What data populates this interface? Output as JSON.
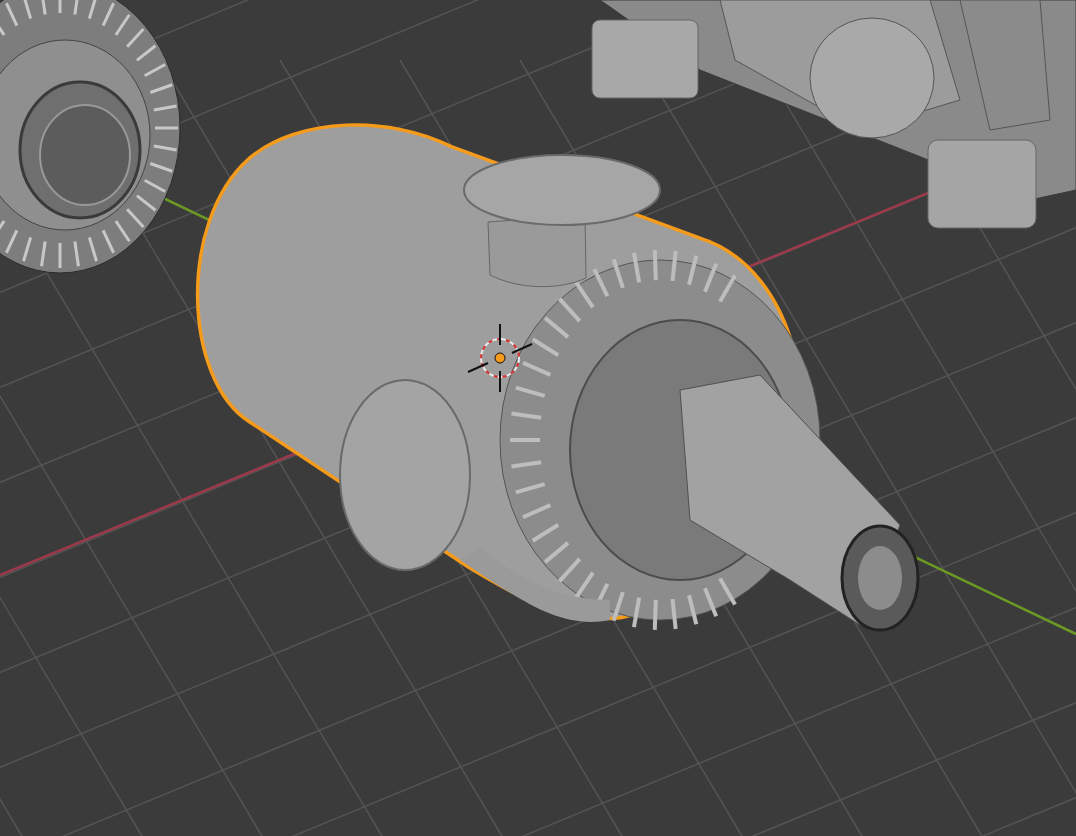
{
  "viewport": {
    "objects": [
      {
        "kind": "turbine",
        "selected": false
      },
      {
        "kind": "pipe",
        "selected": false
      },
      {
        "kind": "tank",
        "selected": true
      }
    ]
  }
}
